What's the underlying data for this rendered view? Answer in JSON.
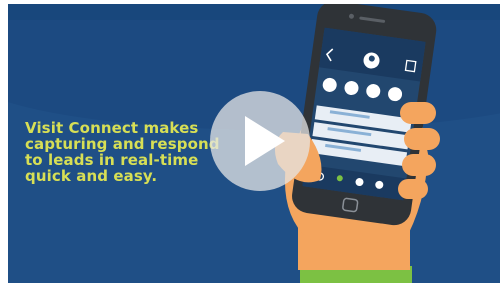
{
  "video": {
    "caption_lines": [
      "Visit Connect makes",
      "capturing and respond",
      "to leads in real-time",
      "quick and easy."
    ],
    "play_label": "",
    "colors": {
      "background": "#1f4f86",
      "caption": "#d7df55",
      "hand": "#f4a55e",
      "phone": "#2f3337",
      "screen": "#22476f",
      "accent": "#7cc143"
    },
    "icons": {
      "play": "play-icon",
      "back": "chevron-left-icon",
      "share": "share-icon",
      "search": "search-icon",
      "add_user": "add-user-icon",
      "settings": "gear-icon",
      "help": "help-icon",
      "home": "home-button-icon"
    }
  }
}
